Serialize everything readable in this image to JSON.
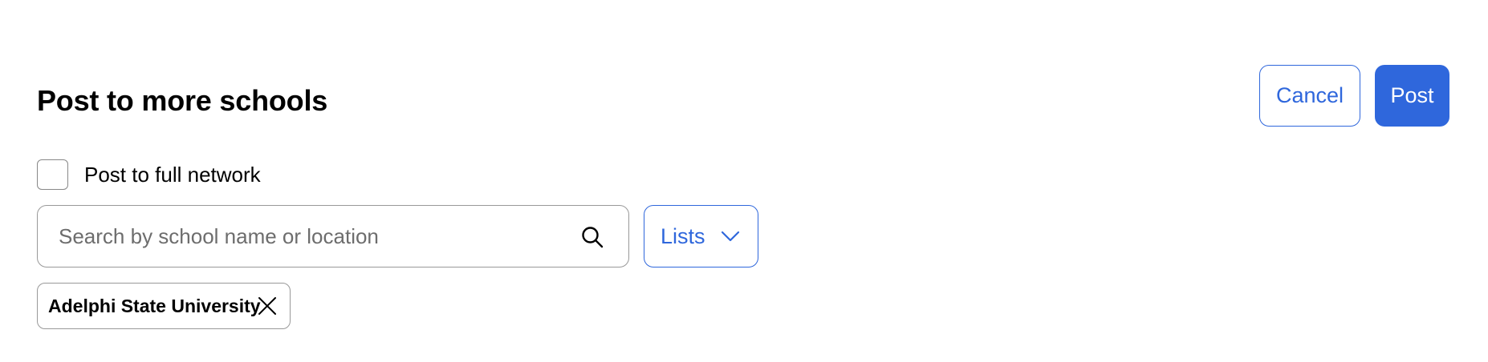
{
  "header": {
    "title": "Post to more schools",
    "cancel_label": "Cancel",
    "post_label": "Post"
  },
  "network_toggle": {
    "label": "Post to full network",
    "checked": false
  },
  "search": {
    "placeholder": "Search by school name or location",
    "value": "",
    "icon": "search-icon"
  },
  "lists_dropdown": {
    "label": "Lists",
    "icon": "chevron-down-icon"
  },
  "selected_schools": [
    {
      "label": "Adelphi State University",
      "icon": "close-icon"
    }
  ],
  "colors": {
    "accent": "#2f67dc",
    "border": "#999999",
    "text": "#000000",
    "placeholder": "#6d6d6d"
  }
}
